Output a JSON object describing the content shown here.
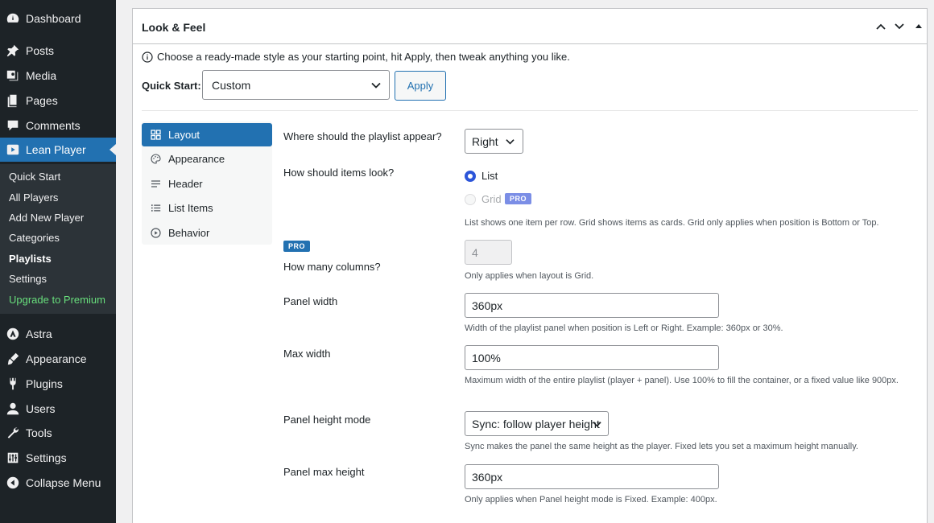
{
  "sidebar": {
    "items": [
      {
        "label": "Dashboard",
        "icon": "dashboard-icon"
      },
      {
        "label": "Posts",
        "icon": "pin-icon"
      },
      {
        "label": "Media",
        "icon": "media-icon"
      },
      {
        "label": "Pages",
        "icon": "pages-icon"
      },
      {
        "label": "Comments",
        "icon": "comment-icon"
      },
      {
        "label": "Lean Player",
        "icon": "play-icon"
      },
      {
        "label": "Astra",
        "icon": "astra-icon"
      },
      {
        "label": "Appearance",
        "icon": "brush-icon"
      },
      {
        "label": "Plugins",
        "icon": "plug-icon"
      },
      {
        "label": "Users",
        "icon": "user-icon"
      },
      {
        "label": "Tools",
        "icon": "wrench-icon"
      },
      {
        "label": "Settings",
        "icon": "sliders-icon"
      },
      {
        "label": "Collapse Menu",
        "icon": "collapse-icon"
      }
    ],
    "submenu": [
      "Quick Start",
      "All Players",
      "Add New Player",
      "Categories",
      "Playlists",
      "Settings",
      "Upgrade to Premium"
    ],
    "current_item": "Lean Player",
    "current_sub": "Playlists",
    "accent_color": "#2271b1",
    "upgrade_color": "#68de7c"
  },
  "panel": {
    "title": "Look & Feel",
    "intro": "Choose a ready-made style as your starting point, hit Apply, then tweak anything you like.",
    "quick_start_label": "Quick Start:",
    "quick_start_value": "Custom",
    "apply_label": "Apply"
  },
  "tabs": [
    {
      "label": "Layout",
      "icon": "grid-icon"
    },
    {
      "label": "Appearance",
      "icon": "palette-icon"
    },
    {
      "label": "Header",
      "icon": "lines-icon"
    },
    {
      "label": "List Items",
      "icon": "list-icon"
    },
    {
      "label": "Behavior",
      "icon": "play-circle-icon"
    }
  ],
  "active_tab": "Layout",
  "settings": {
    "position": {
      "label": "Where should the playlist appear?",
      "value": "Right"
    },
    "look": {
      "label": "How should items look?",
      "option_list": "List",
      "option_grid": "Grid",
      "selected": "List",
      "pro_badge": "PRO",
      "desc": "List shows one item per row. Grid shows items as cards. Grid only applies when position is Bottom or Top."
    },
    "columns": {
      "pro_badge": "PRO",
      "label": "How many columns?",
      "value": "4",
      "desc": "Only applies when layout is Grid."
    },
    "panel_width": {
      "label": "Panel width",
      "value": "360px",
      "desc": "Width of the playlist panel when position is Left or Right. Example: 360px or 30%."
    },
    "max_width": {
      "label": "Max width",
      "value": "100%",
      "desc": "Maximum width of the entire playlist (player + panel). Use 100% to fill the container, or a fixed value like 900px."
    },
    "height_mode": {
      "label": "Panel height mode",
      "value": "Sync: follow player height",
      "desc": "Sync makes the panel the same height as the player. Fixed lets you set a maximum height manually."
    },
    "max_height": {
      "label": "Panel max height",
      "value": "360px",
      "desc": "Only applies when Panel height mode is Fixed. Example: 400px."
    }
  }
}
